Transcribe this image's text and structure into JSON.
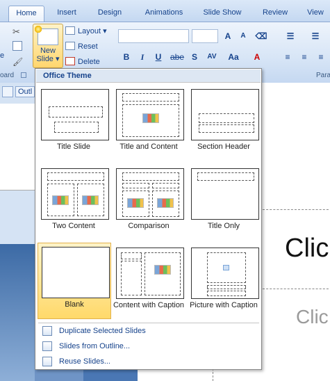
{
  "tabs": [
    {
      "label": "Home",
      "active": true
    },
    {
      "label": "Insert"
    },
    {
      "label": "Design"
    },
    {
      "label": "Animations"
    },
    {
      "label": "Slide Show"
    },
    {
      "label": "Review"
    },
    {
      "label": "View"
    }
  ],
  "ribbon": {
    "new_slide_label": "New",
    "new_slide_label2": "Slide",
    "layout_label": "Layout",
    "reset_label": "Reset",
    "delete_label": "Delete",
    "clipboard_group_fragment": "oard",
    "paragraph_group_fragment": "Para",
    "paste_fragment": "e",
    "bold": "B",
    "italic": "I",
    "underline": "U",
    "strike": "abe",
    "shadow": "S",
    "change_case": "Aa",
    "font_color": "A",
    "grow_font": "A",
    "shrink_font": "A",
    "char_spacing": "AV"
  },
  "left_pane": {
    "outline_tab_fragment": "Outl"
  },
  "slide": {
    "title_fragment": "Clic",
    "subtitle_fragment": "Clic"
  },
  "dropdown": {
    "heading": "Office Theme",
    "layouts": [
      "Title Slide",
      "Title and Content",
      "Section Header",
      "Two Content",
      "Comparison",
      "Title Only",
      "Blank",
      "Content with Caption",
      "Picture with Caption"
    ],
    "commands": [
      {
        "label": "Duplicate Selected Slides",
        "icon": "duplicate-slides-icon"
      },
      {
        "label": "Slides from Outline...",
        "icon": "outline-slides-icon"
      },
      {
        "label": "Reuse Slides...",
        "icon": "reuse-slides-icon"
      }
    ]
  },
  "colors": {
    "ribbon_blue": "#c4d8f1",
    "text_blue": "#15428b",
    "selected_gold": "#ffd96a"
  }
}
